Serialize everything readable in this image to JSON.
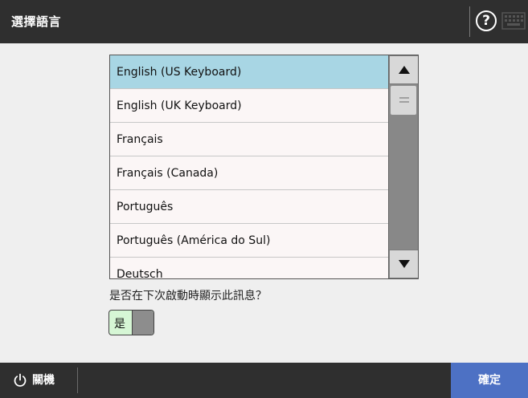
{
  "header": {
    "title": "選擇語言",
    "help_label": "?",
    "help_icon": "help-circle-icon",
    "keyboard_icon": "keyboard-icon"
  },
  "languages": {
    "selected_index": 0,
    "items": [
      "English (US Keyboard)",
      "English (UK Keyboard)",
      "Français",
      "Français (Canada)",
      "Português",
      "Português (América do Sul)",
      "Deutsch"
    ],
    "scroll_up_icon": "triangle-up-icon",
    "scroll_down_icon": "triangle-down-icon"
  },
  "question": {
    "text": "是否在下次啟動時顯示此訊息？"
  },
  "toggle": {
    "label": "是",
    "state": "on"
  },
  "footer": {
    "power_label": "關機",
    "power_icon": "power-icon",
    "ok_label": "確定"
  },
  "colors": {
    "header_bg": "#2f2f2f",
    "selected_row": "#a8d6e4",
    "toggle_on": "#d6f6d5",
    "ok_button": "#4d71c4"
  }
}
